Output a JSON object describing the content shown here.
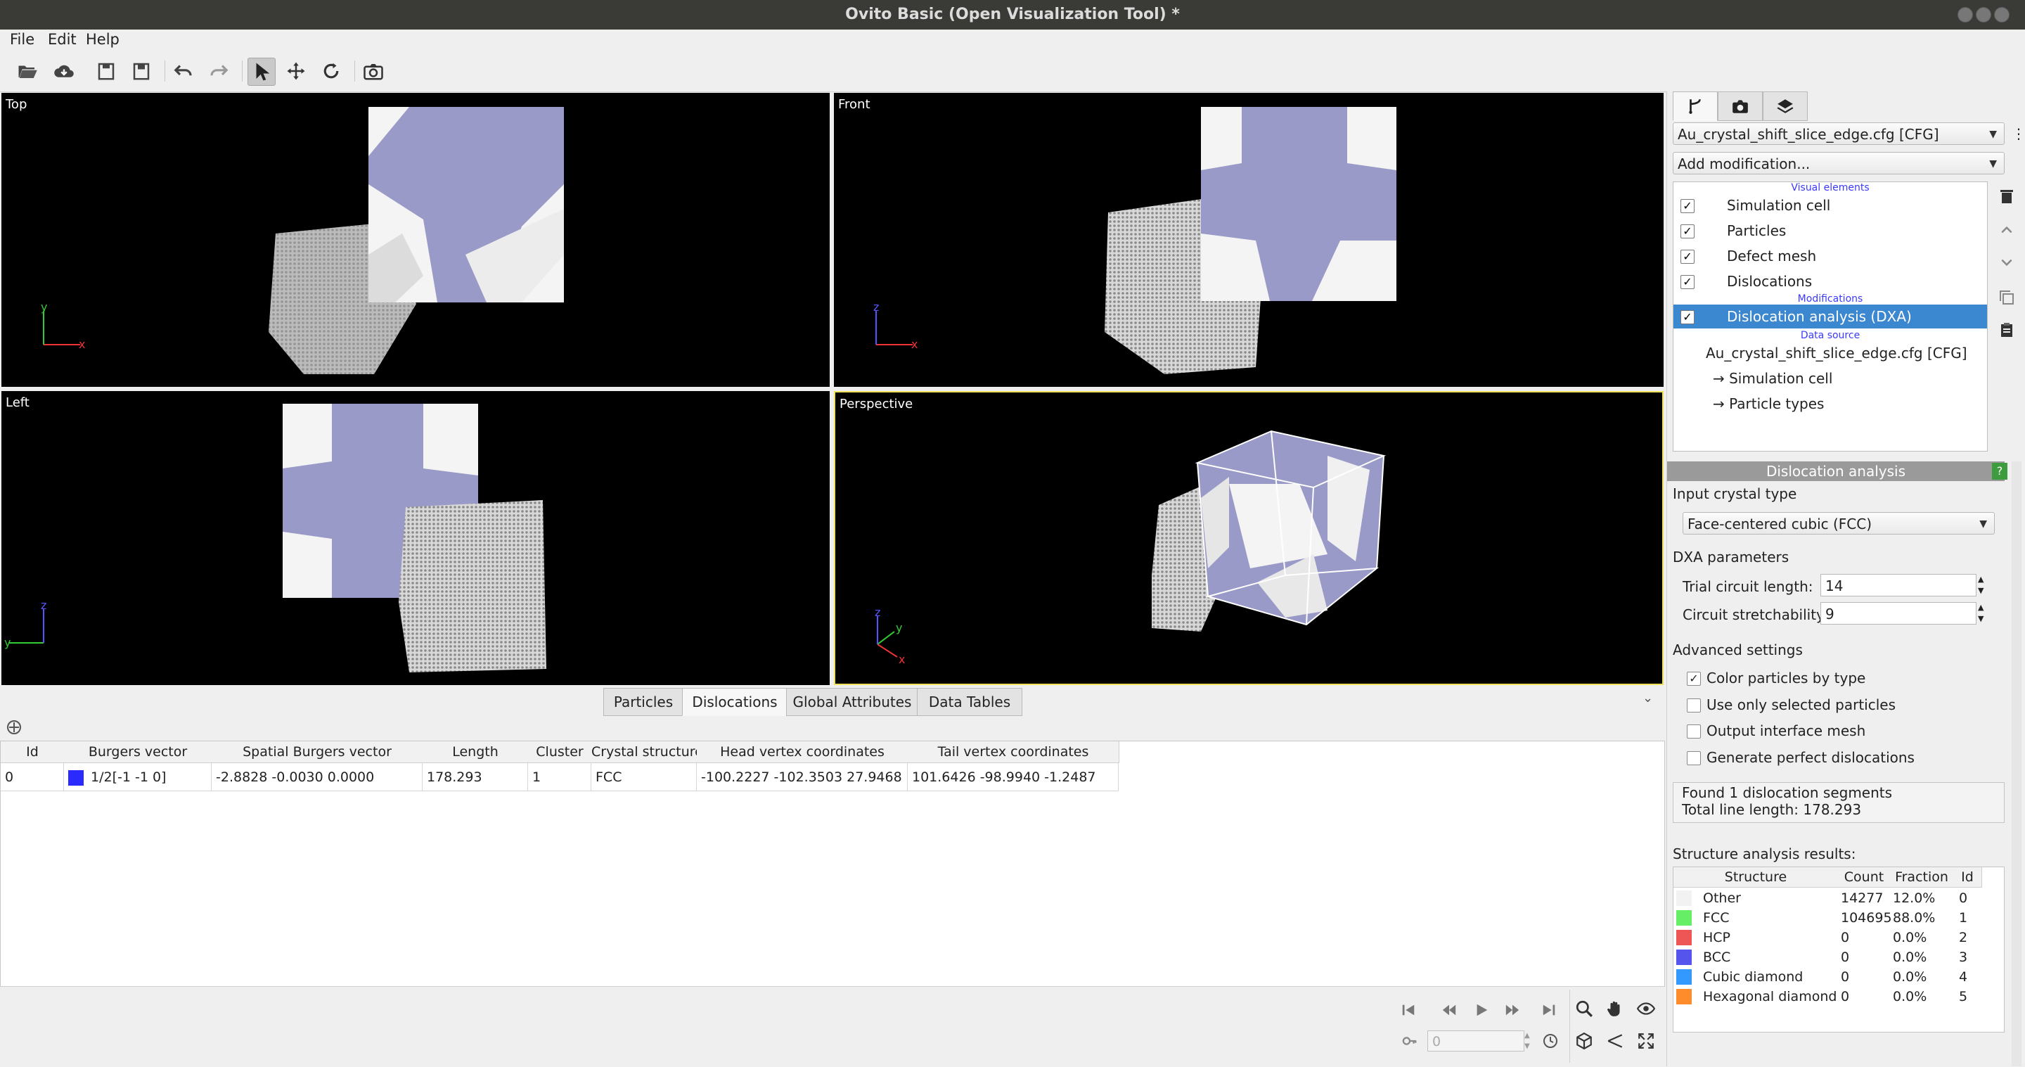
{
  "window": {
    "title": "Ovito Basic (Open Visualization Tool) *"
  },
  "menu": {
    "file": "File",
    "edit": "Edit",
    "help": "Help"
  },
  "viewports": {
    "top": "Top",
    "front": "Front",
    "left": "Left",
    "perspective": "Perspective"
  },
  "axes": {
    "x": "x",
    "y": "y",
    "z": "z"
  },
  "tabs": [
    "Particles",
    "Dislocations",
    "Global Attributes",
    "Data Tables"
  ],
  "table": {
    "headers": [
      "Id",
      "Burgers vector",
      "Spatial Burgers vector",
      "Length",
      "Cluster",
      "Crystal structure",
      "Head vertex coordinates",
      "Tail vertex coordinates"
    ],
    "rows": [
      {
        "id": "0",
        "burgers": "1/2[-1 -1 0]",
        "burgers_color": "#2a2aff",
        "spatial": "-2.8828 -0.0030  0.0000",
        "length": "178.293",
        "cluster": "1",
        "crystal": "FCC",
        "head": "-100.2227 -102.3503 27.9468",
        "tail": "101.6426 -98.9940 -1.2487"
      }
    ]
  },
  "animation": {
    "frame": "0"
  },
  "pipeline": {
    "source_combo": "Au_crystal_shift_slice_edge.cfg [CFG]",
    "add_modification": "Add modification...",
    "visual_elements_header": "Visual elements",
    "visual_elements": [
      "Simulation cell",
      "Particles",
      "Defect mesh",
      "Dislocations"
    ],
    "modifications_header": "Modifications",
    "modification": "Dislocation analysis (DXA)",
    "data_source_header": "Data source",
    "data_source": "Au_crystal_shift_slice_edge.cfg [CFG]",
    "data_source_children": [
      "→ Simulation cell",
      "→ Particle types"
    ]
  },
  "dxa": {
    "title": "Dislocation analysis",
    "help": "?",
    "input_crystal_label": "Input crystal type",
    "input_crystal_value": "Face-centered cubic (FCC)",
    "params_label": "DXA parameters",
    "trial_label": "Trial circuit length:",
    "trial_value": "14",
    "stretch_label": "Circuit stretchability:",
    "stretch_value": "9",
    "advanced_label": "Advanced settings",
    "options": [
      {
        "label": "Color particles by type",
        "checked": "✓"
      },
      {
        "label": "Use only selected particles",
        "checked": ""
      },
      {
        "label": "Output interface mesh",
        "checked": ""
      },
      {
        "label": "Generate perfect dislocations",
        "checked": ""
      }
    ],
    "result_line1": "Found 1 dislocation segments",
    "result_line2": "Total line length: 178.293",
    "structure_label": "Structure analysis results:",
    "structure_headers": [
      "Structure",
      "Count",
      "Fraction",
      "Id"
    ],
    "structures": [
      {
        "name": "Other",
        "count": "14277",
        "fraction": "12.0%",
        "id": "0",
        "color": "#f2f2f2"
      },
      {
        "name": "FCC",
        "count": "104695",
        "fraction": "88.0%",
        "id": "1",
        "color": "#66ee66"
      },
      {
        "name": "HCP",
        "count": "0",
        "fraction": "0.0%",
        "id": "2",
        "color": "#ee5555"
      },
      {
        "name": "BCC",
        "count": "0",
        "fraction": "0.0%",
        "id": "3",
        "color": "#5555ee"
      },
      {
        "name": "Cubic diamond",
        "count": "0",
        "fraction": "0.0%",
        "id": "4",
        "color": "#3399ff"
      },
      {
        "name": "Hexagonal diamond",
        "count": "0",
        "fraction": "0.0%",
        "id": "5",
        "color": "#ff8c2a"
      }
    ]
  },
  "colors": {
    "selection": "#3b87d0",
    "active_viewport_border": "#f2e15a",
    "mesh": "#9a9ac8"
  }
}
